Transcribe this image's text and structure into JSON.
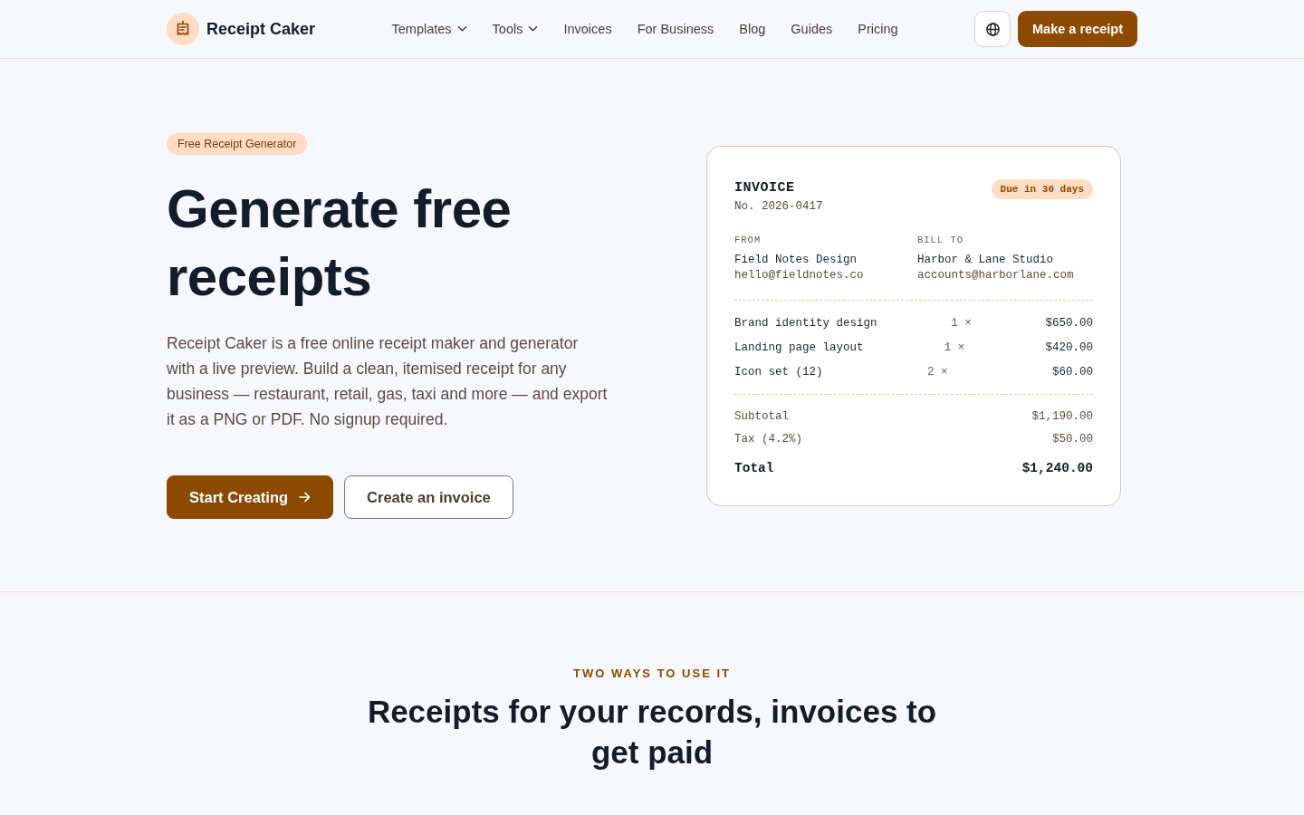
{
  "header": {
    "brand": "Receipt Caker",
    "nav": [
      {
        "label": "Templates",
        "dropdown": true
      },
      {
        "label": "Tools",
        "dropdown": true
      },
      {
        "label": "Invoices",
        "dropdown": false
      },
      {
        "label": "For Business",
        "dropdown": false
      },
      {
        "label": "Blog",
        "dropdown": false
      },
      {
        "label": "Guides",
        "dropdown": false
      },
      {
        "label": "Pricing",
        "dropdown": false
      }
    ],
    "cta": "Make a receipt"
  },
  "hero": {
    "badge": "Free Receipt Generator",
    "title": "Generate free receipts",
    "description": "Receipt Caker is a free online receipt maker and generator with a live preview. Build a clean, itemised receipt for any business — restaurant, retail, gas, taxi and more — and export it as a PNG or PDF. No signup required.",
    "buttons": [
      {
        "label": "Start Creating",
        "kind": "primary"
      },
      {
        "label": "Create an invoice",
        "kind": "secondary"
      }
    ]
  },
  "invoice": {
    "title": "INVOICE",
    "number": "No. 2026-0417",
    "due": "Due in 30 days",
    "parties": [
      {
        "label": "FROM",
        "name": "Field Notes Design",
        "email": "hello@fieldnotes.co"
      },
      {
        "label": "BILL TO",
        "name": "Harbor & Lane Studio",
        "email": "accounts@harborlane.com"
      }
    ],
    "items": [
      {
        "name": "Brand identity design",
        "qty": "1 ×",
        "amount": "$650.00"
      },
      {
        "name": "Landing page layout",
        "qty": "1 ×",
        "amount": "$420.00"
      },
      {
        "name": "Icon set (12)",
        "qty": "2 ×",
        "amount": "$60.00"
      }
    ],
    "totals": [
      {
        "label": "Subtotal",
        "value": "$1,190.00",
        "kind": "line"
      },
      {
        "label": "Tax (4.2%)",
        "value": "$50.00",
        "kind": "line"
      },
      {
        "label": "Total",
        "value": "$1,240.00",
        "kind": "grand"
      }
    ]
  },
  "section": {
    "eyebrow": "TWO WAYS TO USE IT",
    "title": "Receipts for your records, invoices to get paid"
  }
}
